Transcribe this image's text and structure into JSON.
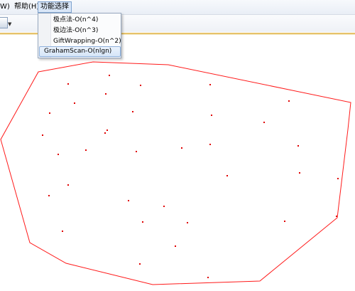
{
  "menubar": {
    "items": [
      {
        "label": "W)"
      },
      {
        "label": "帮助(H)"
      },
      {
        "label": "功能选择"
      }
    ]
  },
  "dropdown": {
    "items": [
      {
        "label": "极点法-O(n^4)"
      },
      {
        "label": "极边法-O(n^3)"
      },
      {
        "label": "GiftWrapping-O(n^2)"
      },
      {
        "label": "GrahamScan-O(nlgn)"
      }
    ],
    "highlighted_index": 3
  },
  "colors": {
    "hull": "#ff1a1a",
    "point": "#e00000",
    "menu_highlight": "#d6e6f8"
  }
}
